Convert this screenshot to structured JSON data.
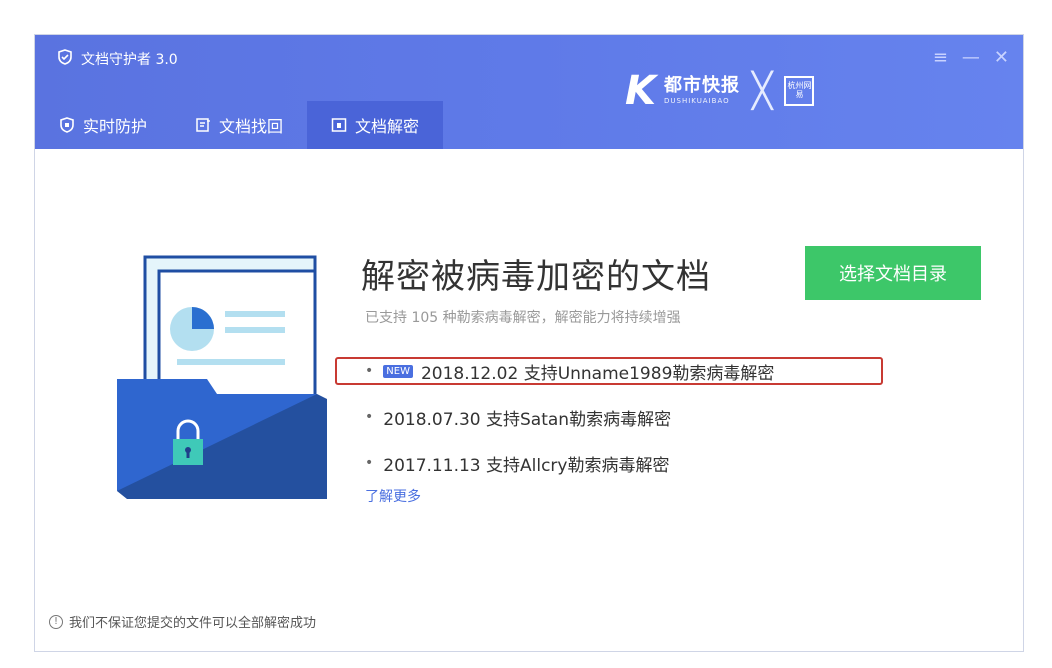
{
  "app": {
    "title": "文档守护者 3.0"
  },
  "window_controls": {
    "menu": "≡",
    "minimize": "—",
    "close": "✕"
  },
  "brand": {
    "k": "K",
    "cn": "都市快报",
    "en": "DUSHIKUAIBAO",
    "sep": "╳",
    "logo": "杭州网易"
  },
  "tabs": [
    {
      "label": "实时防护",
      "icon": "shield-tab-icon"
    },
    {
      "label": "文档找回",
      "icon": "doc-recover-icon"
    },
    {
      "label": "文档解密",
      "icon": "doc-decrypt-icon",
      "active": true
    }
  ],
  "main": {
    "title": "解密被病毒加密的文档",
    "subtitle": "已支持 105 种勒索病毒解密，解密能力将持续增强",
    "select_button": "选择文档目录",
    "updates": [
      {
        "badge": "NEW",
        "text": "2018.12.02 支持Unname1989勒索病毒解密",
        "highlighted": true
      },
      {
        "badge": "",
        "text": "2018.07.30 支持Satan勒索病毒解密"
      },
      {
        "badge": "",
        "text": "2017.11.13 支持Allcry勒索病毒解密"
      }
    ],
    "learn_more": "了解更多"
  },
  "footer": {
    "disclaimer": "我们不保证您提交的文件可以全部解密成功",
    "info_symbol": "!"
  },
  "colors": {
    "titlebar": "#5f7ae8",
    "active_tab": "#4a64d8",
    "button": "#3dc769",
    "highlight": "#c83a33"
  }
}
